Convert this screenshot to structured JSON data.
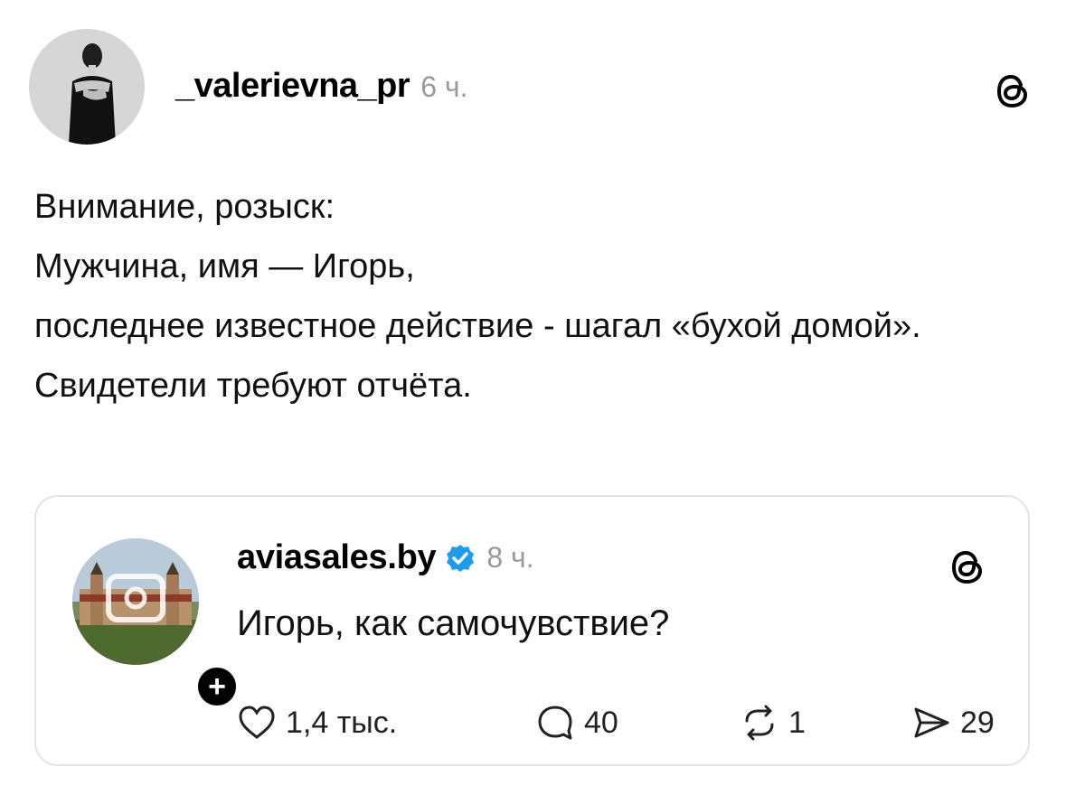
{
  "post": {
    "username": "_valerievna_pr",
    "time": "6 ч.",
    "lines": [
      "Внимание, розыск:",
      "Мужчина, имя — Игорь,",
      "последнее известное действие - шагал «бухой домой».",
      "Свидетели требуют отчёта."
    ]
  },
  "quote": {
    "username": "aviasales.by",
    "time": "8 ч.",
    "text": "Игорь, как самочувствие?",
    "follow_symbol": "+",
    "likes": "1,4 тыс.",
    "comments": "40",
    "reposts": "1",
    "shares": "29"
  },
  "icons": {
    "threads": "threads-logo-icon",
    "verified": "verified-badge-icon",
    "like": "heart-icon",
    "comment": "comment-bubble-icon",
    "repost": "repost-icon",
    "share": "send-icon"
  },
  "colors": {
    "text": "#000000",
    "muted": "#9a9a9a",
    "verified": "#1d9bf0",
    "border": "#e3e3e3"
  }
}
